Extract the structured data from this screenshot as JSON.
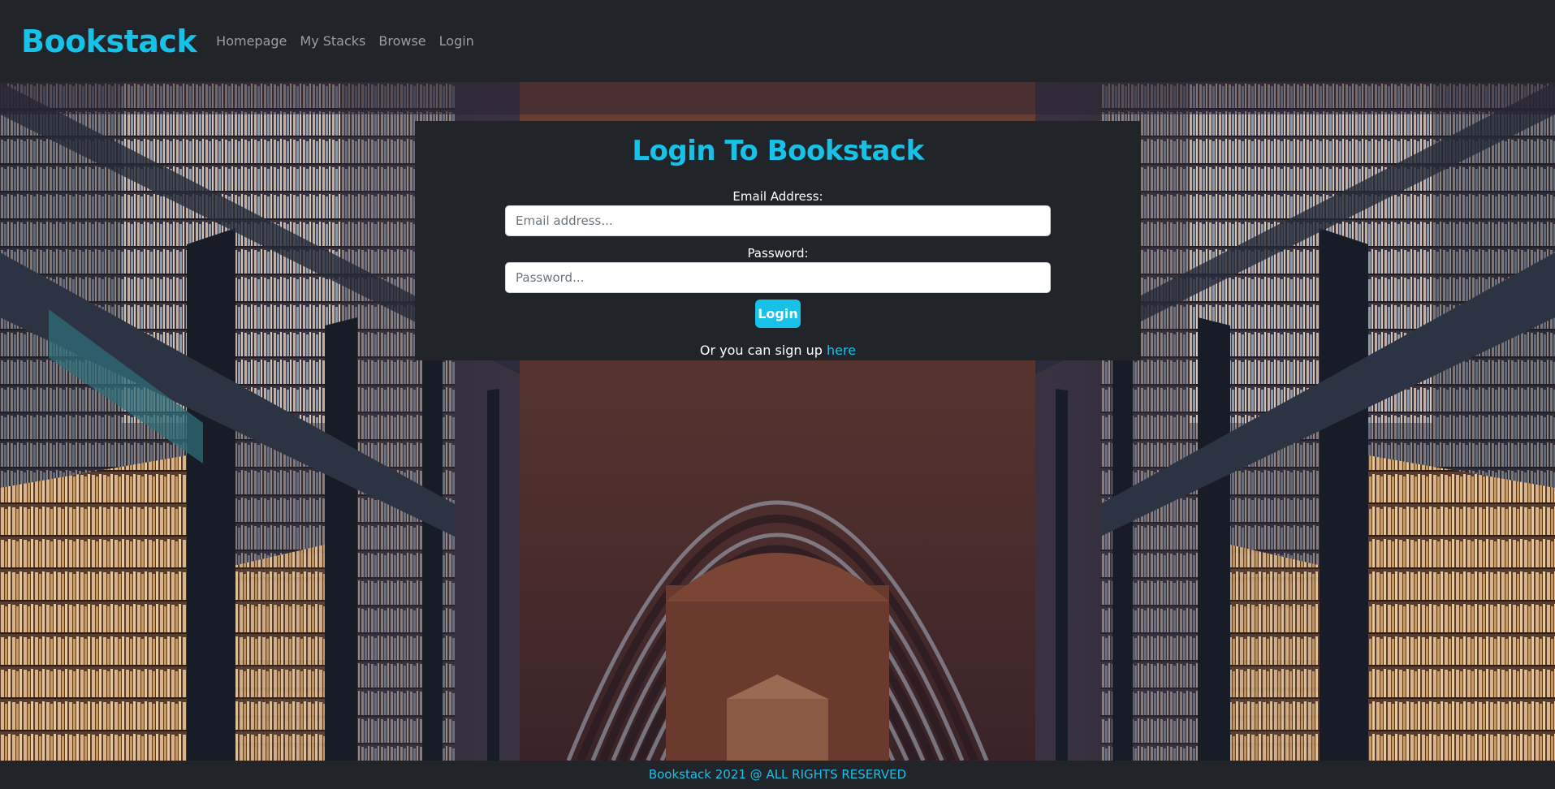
{
  "navbar": {
    "brand": "Bookstack",
    "links": [
      "Homepage",
      "My Stacks",
      "Browse",
      "Login"
    ]
  },
  "login": {
    "title": "Login To Bookstack",
    "email_label": "Email Address:",
    "email_placeholder": "Email address...",
    "password_label": "Password:",
    "password_placeholder": "Password...",
    "button_label": "Login",
    "signup_text": "Or you can sign up ",
    "signup_link": "here"
  },
  "footer": {
    "text": "Bookstack 2021 @ ALL RIGHTS RESERVED"
  },
  "colors": {
    "accent": "#17c1e8",
    "dark": "#212529"
  }
}
